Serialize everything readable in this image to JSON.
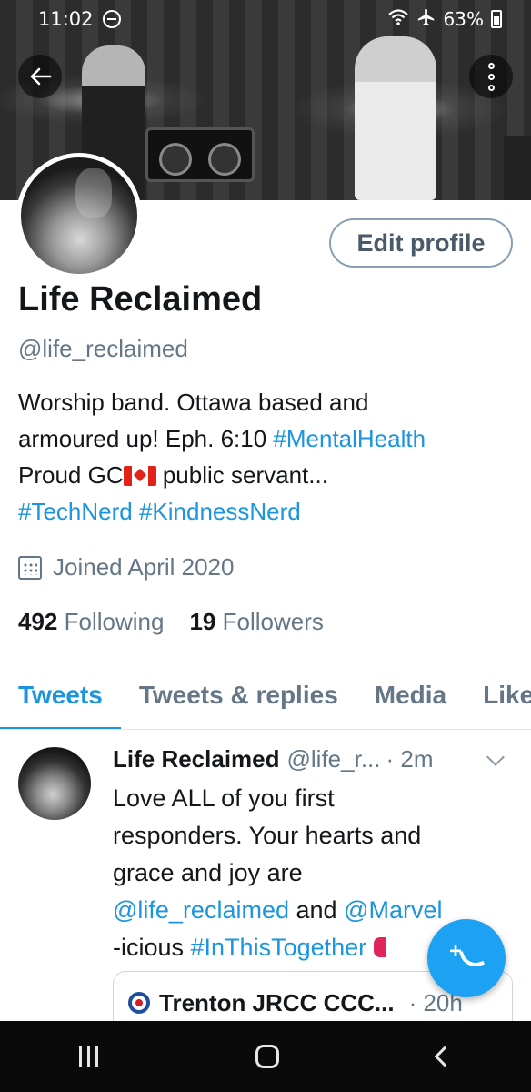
{
  "status_bar": {
    "time": "11:02",
    "battery": "63%",
    "icons": [
      "do-not-disturb-icon",
      "wifi-icon",
      "airplane-icon",
      "battery-icon"
    ]
  },
  "header": {
    "back_icon": "back-arrow-icon",
    "more_icon": "more-vertical-icon"
  },
  "profile": {
    "edit_label": "Edit profile",
    "name": "Life Reclaimed",
    "handle": "@life_reclaimed",
    "bio": {
      "line1": "Worship band. Ottawa based and",
      "line2_text": "armoured up! Eph. 6:10 ",
      "line2_tag": "#MentalHealth",
      "line3_a": "Proud GC",
      "line3_b": " public servant...",
      "line4_tag1": "#TechNerd",
      "line4_tag2": "#KindnessNerd"
    },
    "joined": "Joined April 2020",
    "following_count": "492",
    "following_label": "Following",
    "followers_count": "19",
    "followers_label": "Followers"
  },
  "tabs": [
    {
      "label": "Tweets",
      "active": true
    },
    {
      "label": "Tweets & replies",
      "active": false
    },
    {
      "label": "Media",
      "active": false
    },
    {
      "label": "Likes",
      "active": false
    }
  ],
  "tweet": {
    "name": "Life Reclaimed",
    "handle": "@life_r...",
    "time": "· 2m",
    "line1": "Love ALL of you first",
    "line2": "responders. Your hearts and",
    "line3": "grace and joy are",
    "line4_mention1": "@life_reclaimed",
    "line4_and": " and ",
    "line4_mention2": "@Marvel",
    "line5_text": "-icious  ",
    "line5_tag": "#InThisTogether",
    "quote_name": "Trenton JRCC CCC...",
    "quote_time": "· 20h"
  },
  "fab": {
    "plus": "+",
    "icon": "compose-tweet-icon"
  },
  "navbar": {
    "icons": [
      "recent-apps-icon",
      "home-icon",
      "back-icon"
    ]
  },
  "colors": {
    "accent": "#1b95e0",
    "secondary_text": "#657786",
    "fab": "#1da1f2"
  }
}
